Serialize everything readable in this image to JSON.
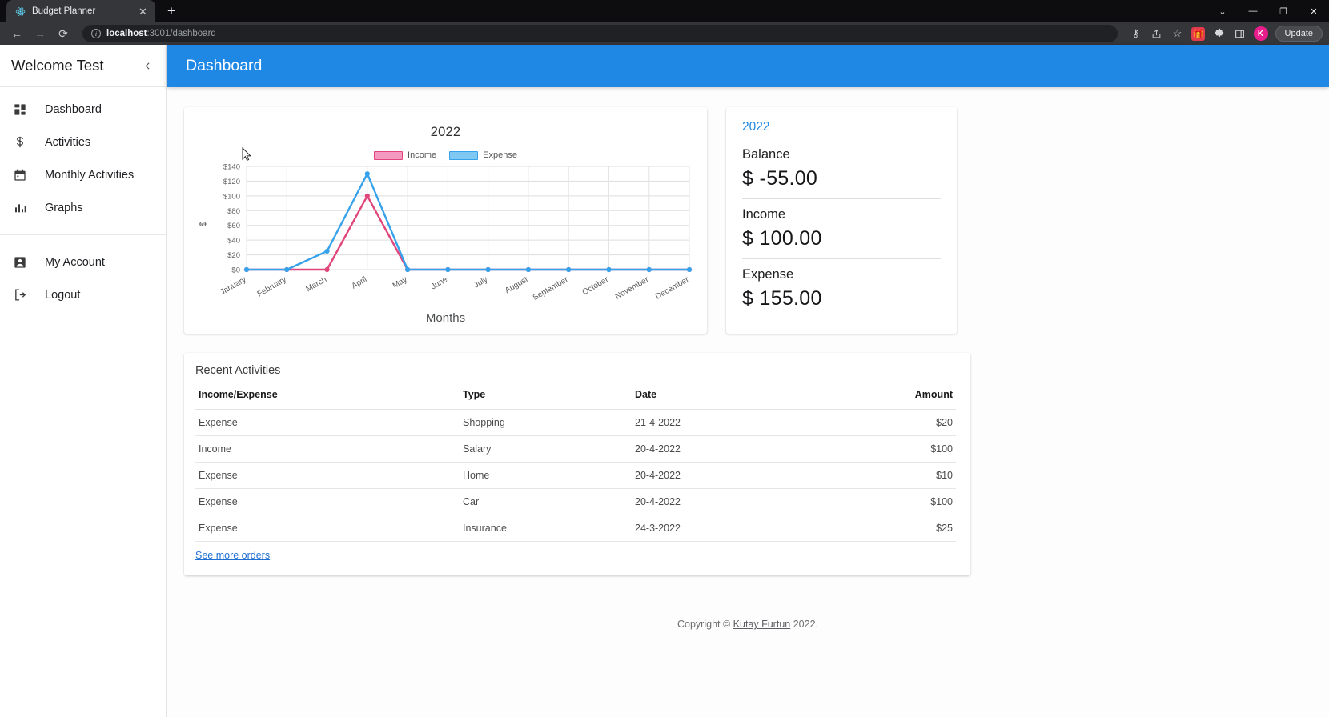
{
  "browser": {
    "tab": {
      "title": "Budget Planner",
      "favicon_icon": "react-atom-icon",
      "close_icon": "close-icon"
    },
    "new_tab_icon": "plus-icon",
    "window_controls": [
      {
        "name": "chrome-menu-chevron",
        "glyph": "⌄"
      },
      {
        "name": "minimize-window",
        "glyph": "—"
      },
      {
        "name": "restore-window",
        "glyph": "❐"
      },
      {
        "name": "close-window",
        "glyph": "✕"
      }
    ],
    "nav": {
      "back_icon": "back-arrow-icon",
      "forward_icon": "forward-arrow-icon",
      "reload_icon": "reload-icon"
    },
    "omnibox": {
      "info_icon": "site-info-icon",
      "url_host": "localhost",
      "url_rest": ":3001/dashboard",
      "full_url": "localhost:3001/dashboard"
    },
    "toolbar_icons": [
      {
        "name": "password-key-icon",
        "glyph": "⚷"
      },
      {
        "name": "share-icon",
        "glyph": "↗"
      },
      {
        "name": "bookmark-star-icon",
        "glyph": "☆"
      },
      {
        "name": "extension-gift-icon",
        "glyph": "🎁"
      },
      {
        "name": "extensions-puzzle-icon",
        "glyph": "✜"
      },
      {
        "name": "side-panel-icon",
        "glyph": "▣"
      }
    ],
    "profile_avatar_letter": "K",
    "update_button_label": "Update"
  },
  "sidebar": {
    "welcome": "Welcome Test",
    "collapse_icon": "chevron-left-icon",
    "groups": [
      {
        "items": [
          {
            "label": "Dashboard",
            "icon": "dashboard-grid-icon"
          },
          {
            "label": "Activities",
            "icon": "dollar-sign-icon"
          },
          {
            "label": "Monthly Activities",
            "icon": "calendar-icon"
          },
          {
            "label": "Graphs",
            "icon": "bar-chart-icon"
          }
        ]
      },
      {
        "items": [
          {
            "label": "My Account",
            "icon": "user-account-icon"
          },
          {
            "label": "Logout",
            "icon": "logout-icon"
          }
        ]
      }
    ]
  },
  "appbar": {
    "title": "Dashboard"
  },
  "chart_data": {
    "type": "line",
    "title": "2022",
    "xlabel": "Months",
    "ylabel": "$",
    "categories": [
      "January",
      "February",
      "March",
      "April",
      "May",
      "June",
      "July",
      "August",
      "September",
      "October",
      "November",
      "December"
    ],
    "series": [
      {
        "name": "Income",
        "color": "#e0457b",
        "values": [
          0,
          0,
          0,
          100,
          0,
          0,
          0,
          0,
          0,
          0,
          0,
          0
        ]
      },
      {
        "name": "Expense",
        "color": "#36a2eb",
        "values": [
          0,
          0,
          25,
          130,
          0,
          0,
          0,
          0,
          0,
          0,
          0,
          0
        ]
      }
    ],
    "ylim": [
      0,
      140
    ],
    "yticks": [
      "$0",
      "$20",
      "$40",
      "$60",
      "$80",
      "$100",
      "$120",
      "$140"
    ],
    "ytick_values": [
      0,
      20,
      40,
      60,
      80,
      100,
      120,
      140
    ],
    "grid": true,
    "legend_position": "top"
  },
  "balance_card": {
    "year": "2022",
    "rows": [
      {
        "label": "Balance",
        "value": "$ -55.00"
      },
      {
        "label": "Income",
        "value": "$ 100.00"
      },
      {
        "label": "Expense",
        "value": "$ 155.00"
      }
    ]
  },
  "activities": {
    "title": "Recent Activities",
    "columns": [
      "Income/Expense",
      "Type",
      "Date",
      "Amount"
    ],
    "rows": [
      {
        "kind": "Expense",
        "type": "Shopping",
        "date": "21-4-2022",
        "amount": "$20"
      },
      {
        "kind": "Income",
        "type": "Salary",
        "date": "20-4-2022",
        "amount": "$100"
      },
      {
        "kind": "Expense",
        "type": "Home",
        "date": "20-4-2022",
        "amount": "$10"
      },
      {
        "kind": "Expense",
        "type": "Car",
        "date": "20-4-2022",
        "amount": "$100"
      },
      {
        "kind": "Expense",
        "type": "Insurance",
        "date": "24-3-2022",
        "amount": "$25"
      }
    ],
    "see_more_label": "See more orders"
  },
  "footer": {
    "prefix": "Copyright © ",
    "link": "Kutay Furtun",
    "suffix": " 2022."
  },
  "colors": {
    "appbar_blue": "#1f88e5",
    "income_pink": "#e0457b",
    "expense_blue": "#36a2eb",
    "link_blue": "#1f6fd0"
  }
}
